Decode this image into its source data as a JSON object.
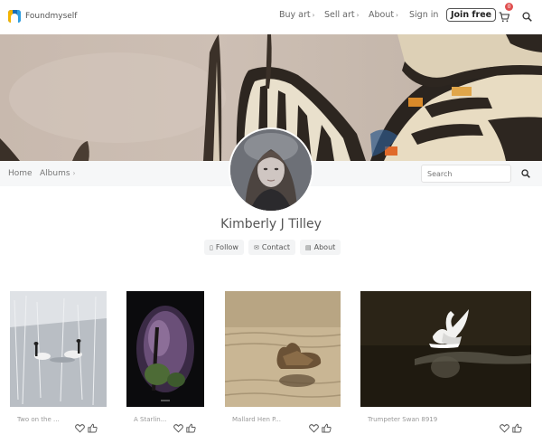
{
  "brand": {
    "name": "Foundmyself"
  },
  "nav": {
    "buy_art": "Buy art",
    "sell_art": "Sell art",
    "about": "About",
    "sign_in": "Sign in",
    "join_free": "Join free",
    "cart_count": "0"
  },
  "subnav": {
    "home": "Home",
    "albums": "Albums",
    "search_placeholder": "Search"
  },
  "profile": {
    "name": "Kimberly J Tilley",
    "follow": "Follow",
    "contact": "Contact",
    "about": "About"
  },
  "gallery": [
    {
      "title": "Two on the ..."
    },
    {
      "title": "A Starlin..."
    },
    {
      "title": "Mallard Hen P..."
    },
    {
      "title": "Trumpeter Swan 8919"
    }
  ],
  "icons": {
    "heart": "heart-icon",
    "thumb": "thumbs-up-icon",
    "cart": "cart-icon",
    "search": "search-icon"
  },
  "colors": {
    "badge": "#e05050",
    "subnav_bg": "#f6f7f8",
    "logo_blue": "#1a6fb8",
    "logo_yellow": "#f4b400"
  }
}
